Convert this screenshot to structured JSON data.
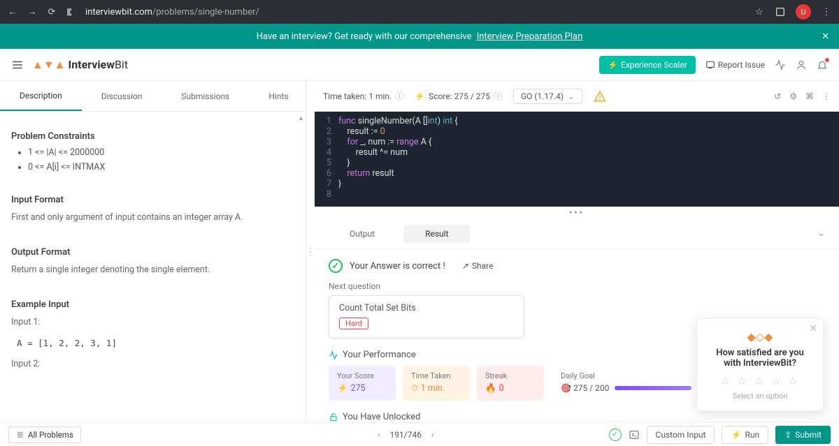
{
  "browser": {
    "url_host": "interviewbit.com",
    "url_path": "/problems/single-number/",
    "avatar_letter": "U"
  },
  "banner": {
    "text_pre": "Have an interview? Get ready with our comprehensive",
    "link": "Interview Preparation Plan"
  },
  "header": {
    "brand_pre": "Interview",
    "brand_post": "Bit",
    "scaler": "Experience Scaler",
    "report": "Report Issue"
  },
  "tabs": [
    "Description",
    "Discussion",
    "Submissions",
    "Hints"
  ],
  "active_tab": 0,
  "problem": {
    "constraints_title": "Problem Constraints",
    "constraints": [
      "1 <= |A| <= 2000000",
      "0 <= A[i] <= INTMAX"
    ],
    "input_format_title": "Input Format",
    "input_format": "First and only argument of input contains an integer array A.",
    "output_format_title": "Output Format",
    "output_format": "Return a single integer denoting the single element.",
    "example_title": "Example Input",
    "example_in1_label": "Input 1:",
    "example_in1": "A = [1, 2, 2, 3, 1]",
    "example_in2_label": "Input 2:"
  },
  "toolbar": {
    "time_label": "Time taken: 1 min.",
    "score_label": "Score: 275 / 275",
    "language": "GO (1.17.4)"
  },
  "code_lines": [
    {
      "ln": "1",
      "raw": "func singleNumber(A []int) int {"
    },
    {
      "ln": "2",
      "raw": "    result := 0"
    },
    {
      "ln": "3",
      "raw": "    for _, num := range A {"
    },
    {
      "ln": "4",
      "raw": "        result ^= num"
    },
    {
      "ln": "5",
      "raw": "    }"
    },
    {
      "ln": "6",
      "raw": "    return result"
    },
    {
      "ln": "7",
      "raw": "}"
    },
    {
      "ln": "8",
      "raw": ""
    }
  ],
  "output_tabs": {
    "output": "Output",
    "result": "Result"
  },
  "result": {
    "correct": "Your Answer is correct !",
    "share": "Share",
    "nextq_label": "Next question",
    "next_title": "Count Total Set Bits",
    "next_diff": "Hard",
    "perf_title": "Your Performance",
    "score_label": "Your Score",
    "score_val": "275",
    "time_label": "Time Taken",
    "time_val": "1 min.",
    "streak_label": "Streak",
    "streak_val": "0",
    "goal_label": "Daily Goal",
    "goal_val": "275 / 200",
    "unlock_title": "You Have Unlocked"
  },
  "bottom": {
    "all": "All Problems",
    "pos": "191/746",
    "custom": "Custom Input",
    "run": "Run",
    "submit": "Submit"
  },
  "survey": {
    "q": "How satisfied are you with InterviewBit?",
    "select": "Select an option"
  }
}
